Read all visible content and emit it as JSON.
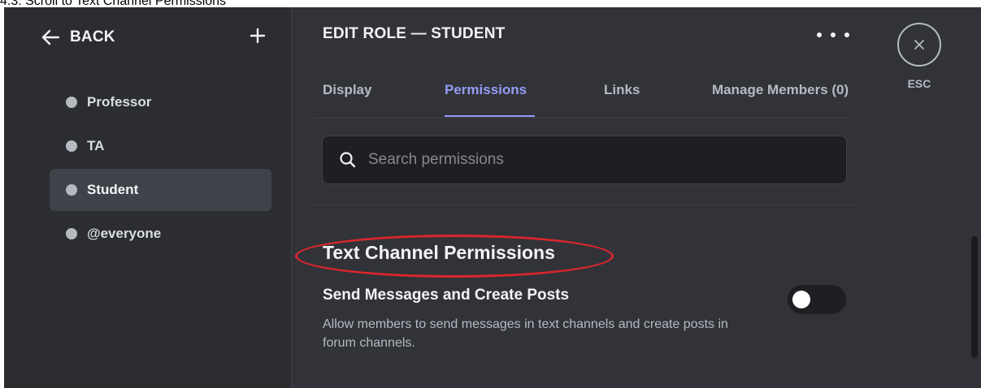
{
  "caption": "4.3: Scroll to Text Channel Permissions",
  "sidebar": {
    "back_label": "BACK",
    "add_icon": "plus-icon",
    "roles": [
      {
        "label": "Professor",
        "active": false
      },
      {
        "label": "TA",
        "active": false
      },
      {
        "label": "Student",
        "active": true
      },
      {
        "label": "@everyone",
        "active": false
      }
    ]
  },
  "header": {
    "title": "EDIT ROLE — STUDENT",
    "more_icon": "more-dots-icon",
    "esc_label": "ESC"
  },
  "tabs": [
    {
      "label": "Display",
      "active": false
    },
    {
      "label": "Permissions",
      "active": true
    },
    {
      "label": "Links",
      "active": false
    },
    {
      "label": "Manage Members (0)",
      "active": false
    }
  ],
  "search": {
    "placeholder": "Search permissions"
  },
  "section": {
    "heading": "Text Channel Permissions"
  },
  "permissions": [
    {
      "title": "Send Messages and Create Posts",
      "description": "Allow members to send messages in text channels and create posts in forum channels.",
      "enabled": false
    }
  ],
  "colors": {
    "accent": "#949cf7",
    "annotation": "#d8262c",
    "background": "#313338",
    "sidebar": "#2b2d31"
  }
}
